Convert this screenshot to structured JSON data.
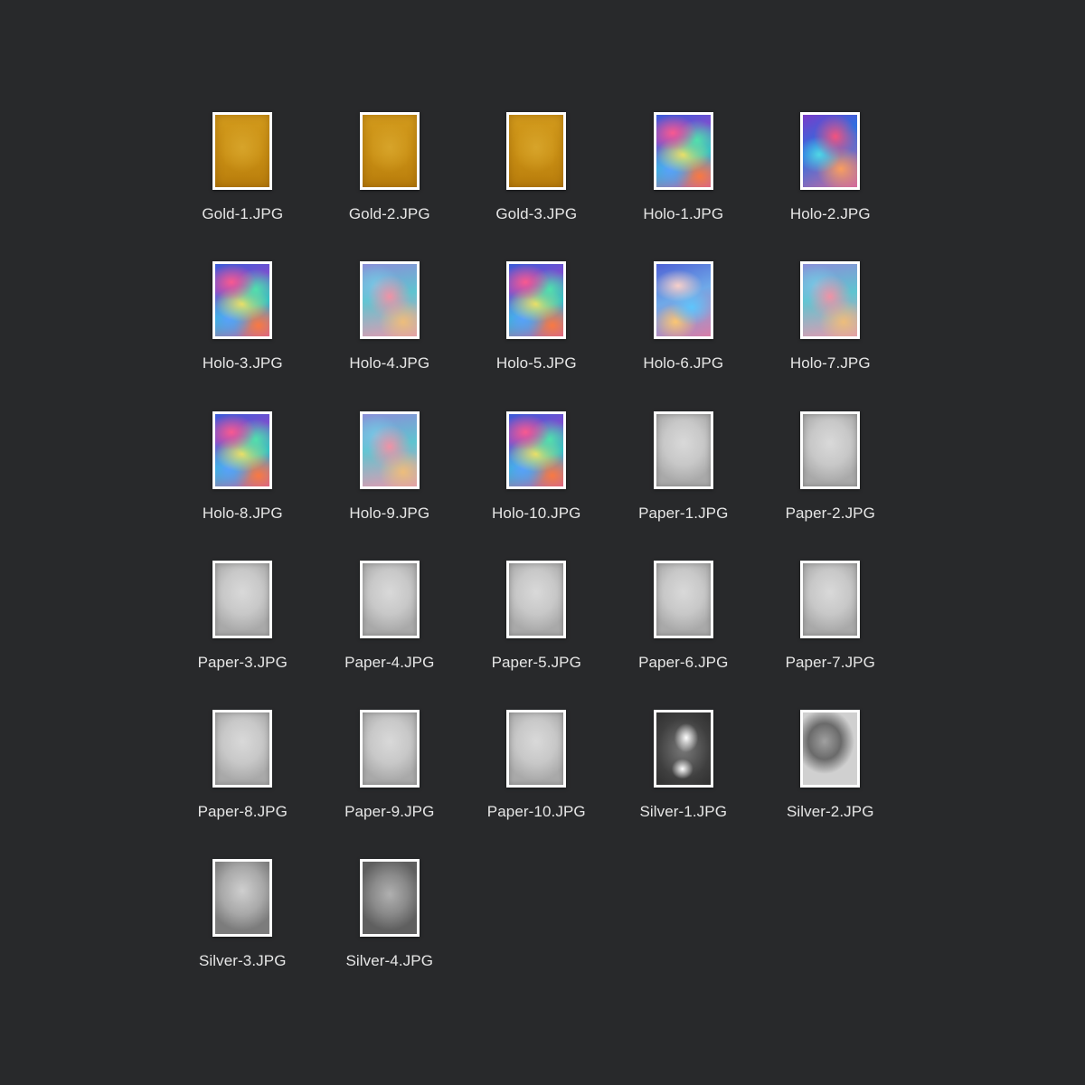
{
  "files": [
    {
      "name": "Gold-1.JPG",
      "kind": "gold",
      "variant": ""
    },
    {
      "name": "Gold-2.JPG",
      "kind": "gold",
      "variant": ""
    },
    {
      "name": "Gold-3.JPG",
      "kind": "gold",
      "variant": ""
    },
    {
      "name": "Holo-1.JPG",
      "kind": "holo",
      "variant": "h1"
    },
    {
      "name": "Holo-2.JPG",
      "kind": "holo",
      "variant": "h2"
    },
    {
      "name": "Holo-3.JPG",
      "kind": "holo",
      "variant": "h3"
    },
    {
      "name": "Holo-4.JPG",
      "kind": "holo",
      "variant": "h4"
    },
    {
      "name": "Holo-5.JPG",
      "kind": "holo",
      "variant": "h5"
    },
    {
      "name": "Holo-6.JPG",
      "kind": "holo",
      "variant": "h6"
    },
    {
      "name": "Holo-7.JPG",
      "kind": "holo",
      "variant": "h7"
    },
    {
      "name": "Holo-8.JPG",
      "kind": "holo",
      "variant": "h8"
    },
    {
      "name": "Holo-9.JPG",
      "kind": "holo",
      "variant": "h9"
    },
    {
      "name": "Holo-10.JPG",
      "kind": "holo",
      "variant": "h10"
    },
    {
      "name": "Paper-1.JPG",
      "kind": "paper",
      "variant": ""
    },
    {
      "name": "Paper-2.JPG",
      "kind": "paper",
      "variant": ""
    },
    {
      "name": "Paper-3.JPG",
      "kind": "paper",
      "variant": ""
    },
    {
      "name": "Paper-4.JPG",
      "kind": "paper",
      "variant": ""
    },
    {
      "name": "Paper-5.JPG",
      "kind": "paper",
      "variant": ""
    },
    {
      "name": "Paper-6.JPG",
      "kind": "paper",
      "variant": ""
    },
    {
      "name": "Paper-7.JPG",
      "kind": "paper",
      "variant": ""
    },
    {
      "name": "Paper-8.JPG",
      "kind": "paper",
      "variant": ""
    },
    {
      "name": "Paper-9.JPG",
      "kind": "paper",
      "variant": ""
    },
    {
      "name": "Paper-10.JPG",
      "kind": "paper",
      "variant": ""
    },
    {
      "name": "Silver-1.JPG",
      "kind": "silver",
      "variant": "s1"
    },
    {
      "name": "Silver-2.JPG",
      "kind": "silver",
      "variant": "s2"
    },
    {
      "name": "Silver-3.JPG",
      "kind": "silver",
      "variant": "s3"
    },
    {
      "name": "Silver-4.JPG",
      "kind": "silver",
      "variant": "s4"
    }
  ],
  "colors": {
    "background": "#28292b",
    "label": "#e6e6e6",
    "thumb_border": "#ffffff"
  }
}
